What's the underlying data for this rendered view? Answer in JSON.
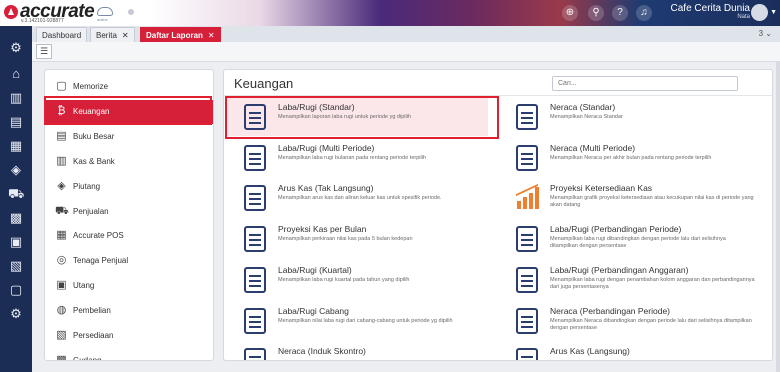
{
  "app": {
    "logo": "accurate",
    "version": "v.3.142101-928877",
    "cloud_label": "online"
  },
  "header": {
    "company": "Cafe Cerita Dunia",
    "user": "Nata"
  },
  "tabs": [
    {
      "label": "Dashboard",
      "closable": false,
      "active": false
    },
    {
      "label": "Berita",
      "closable": true,
      "active": false
    },
    {
      "label": "Daftar Laporan",
      "closable": true,
      "active": true
    }
  ],
  "tab_count": "3",
  "categories": [
    {
      "label": "Memorize",
      "icon": "memorize-icon",
      "glyph": "▢"
    },
    {
      "label": "Keuangan",
      "icon": "finance-icon",
      "glyph": "₿",
      "active": true
    },
    {
      "label": "Buku Besar",
      "icon": "ledger-icon",
      "glyph": "▤"
    },
    {
      "label": "Kas & Bank",
      "icon": "cash-bank-icon",
      "glyph": "▥"
    },
    {
      "label": "Piutang",
      "icon": "receivable-icon",
      "glyph": "◈"
    },
    {
      "label": "Penjualan",
      "icon": "sales-cart-icon",
      "glyph": "⛟"
    },
    {
      "label": "Accurate POS",
      "icon": "pos-icon",
      "glyph": "▦"
    },
    {
      "label": "Tenaga Penjual",
      "icon": "salesperson-icon",
      "glyph": "◎"
    },
    {
      "label": "Utang",
      "icon": "payable-icon",
      "glyph": "▣"
    },
    {
      "label": "Pembelian",
      "icon": "purchase-icon",
      "glyph": "◍"
    },
    {
      "label": "Persediaan",
      "icon": "inventory-icon",
      "glyph": "▧"
    },
    {
      "label": "Gudang",
      "icon": "warehouse-icon",
      "glyph": "▩"
    }
  ],
  "reports_panel": {
    "title": "Keuangan",
    "search_placeholder": "Cari..."
  },
  "reports": [
    {
      "name": "Laba/Rugi (Standar)",
      "desc": "Menampilkan laporan laba rugi untuk periode yg dipilih",
      "selected": true
    },
    {
      "name": "Neraca (Standar)",
      "desc": "Menampilkan Neraca Standar"
    },
    {
      "name": "Laba/Rugi (Multi Periode)",
      "desc": "Menampilkan laba rugi bulanan pada rentang periode terpilih"
    },
    {
      "name": "Neraca (Multi Periode)",
      "desc": "Menampilkan Neraca per akhir bulan pada rentang periode terpilih"
    },
    {
      "name": "Arus Kas (Tak Langsung)",
      "desc": "Menampilkan arus kas dan aliran keluar kas untuk spesifik periode."
    },
    {
      "name": "Proyeksi Ketersediaan Kas",
      "desc": "Menampilkan grafik proyeksi ketersediaan atau kecukupan nilai kas di periode yang akan datang",
      "chart": true
    },
    {
      "name": "Proyeksi Kas per Bulan",
      "desc": "Menampilkan perkiraan nilai kas pada 5 bulan kedepan"
    },
    {
      "name": "Laba/Rugi (Perbandingan Periode)",
      "desc": "Menampilkan laba rugi dibandingkan dengan periode lalu dari selisihnya ditampilkan dengan persentase"
    },
    {
      "name": "Laba/Rugi (Kuartal)",
      "desc": "Menampilkan laba rugi kuartal pada tahun yang dipilih"
    },
    {
      "name": "Laba/Rugi (Perbandingan Anggaran)",
      "desc": "Menampilkan laba rugi dengan penambahan kolom anggaran dan perbandingannya dari juga persentasenya"
    },
    {
      "name": "Laba/Rugi Cabang",
      "desc": "Menampilkan nilai laba rugi dari cabang-cabang untuk periode yg dipilih"
    },
    {
      "name": "Neraca (Perbandingan Periode)",
      "desc": "Menampilkan Neraca dibandingkan dengan periode lalu dari selisihnya ditampilkan dengan persentase"
    },
    {
      "name": "Neraca (Induk Skontro)",
      "desc": ""
    },
    {
      "name": "Arus Kas (Langsung)",
      "desc": ""
    }
  ],
  "colors": {
    "accent": "#d6203a",
    "rail": "#1c2d55",
    "highlight_border": "#e02030",
    "icon": "#2a3d6e"
  }
}
